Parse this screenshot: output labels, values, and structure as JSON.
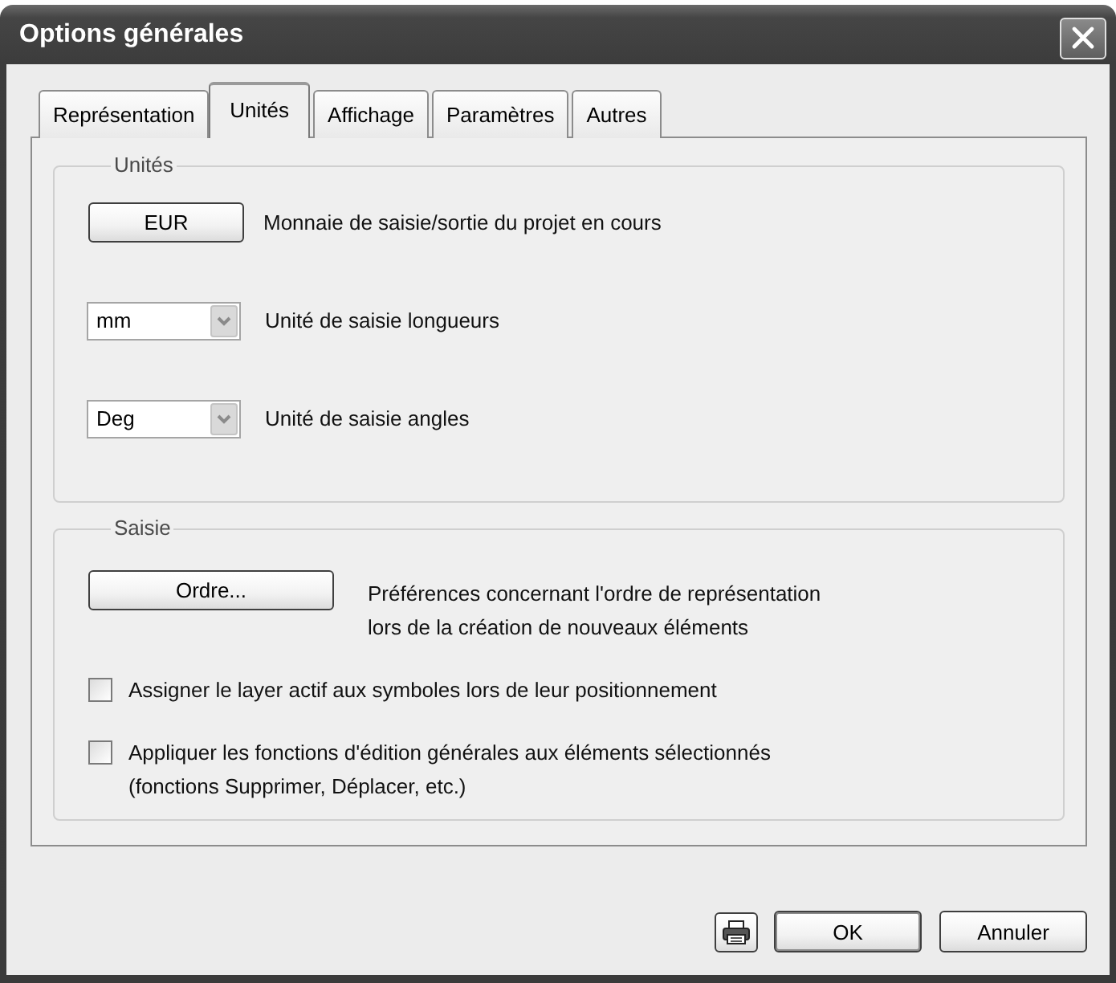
{
  "window": {
    "title": "Options générales"
  },
  "tabs": [
    {
      "label": "Représentation",
      "selected": false
    },
    {
      "label": "Unités",
      "selected": true
    },
    {
      "label": "Affichage",
      "selected": false
    },
    {
      "label": "Paramètres",
      "selected": false
    },
    {
      "label": "Autres",
      "selected": false
    }
  ],
  "groups": [
    {
      "legend": "Unités",
      "rows": [
        {
          "kind": "button",
          "button": "EUR",
          "label": "Monnaie de saisie/sortie du projet en cours"
        },
        {
          "kind": "dropdown",
          "value": "mm",
          "label": "Unité de saisie longueurs"
        },
        {
          "kind": "dropdown",
          "value": "Deg",
          "label": "Unité de saisie angles"
        }
      ]
    },
    {
      "legend": "Saisie",
      "rows": [
        {
          "kind": "button",
          "button": "Ordre...",
          "label": "Préférences concernant l'ordre de représentation\nlors de la création de nouveaux éléments"
        },
        {
          "kind": "checkbox",
          "checked": false,
          "label": "Assigner le layer actif aux symboles lors de leur positionnement"
        },
        {
          "kind": "checkbox",
          "checked": false,
          "label": "Appliquer les fonctions d'édition générales aux éléments sélectionnés\n(fonctions Supprimer, Déplacer, etc.)"
        }
      ]
    }
  ],
  "buttons": [
    {
      "kind": "print"
    },
    {
      "kind": "text",
      "label": "OK",
      "default": true
    },
    {
      "kind": "text",
      "label": "Annuler",
      "default": false
    }
  ]
}
